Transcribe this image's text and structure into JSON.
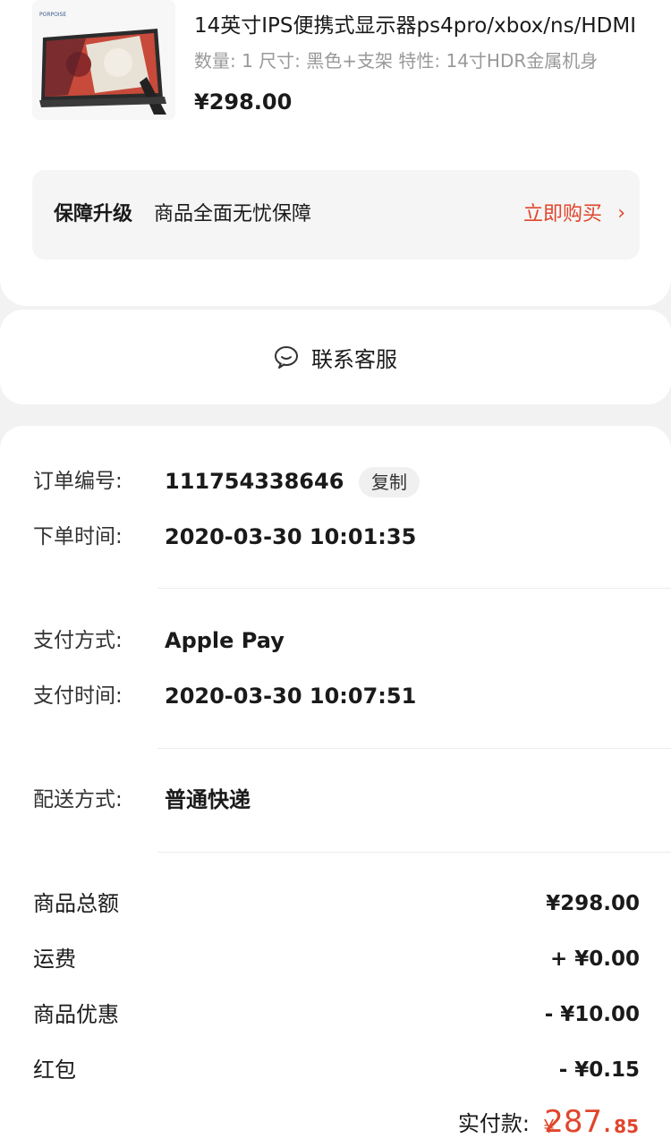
{
  "product": {
    "image_brand": "PORPOISE",
    "title": "14英寸IPS便携式显示器ps4pro/xbox/ns/HDMI",
    "spec": "数量: 1  尺寸: 黑色+支架  特性: 14寸HDR金属机身",
    "price": "¥298.00"
  },
  "guarantee": {
    "label": "保障升级",
    "description": "商品全面无忧保障",
    "action": "立即购买",
    "chevron": "›"
  },
  "service": {
    "icon": "chat-bubble-icon",
    "label": "联系客服"
  },
  "order": {
    "number_label": "订单编号:",
    "number": "111754338646",
    "copy_label": "复制",
    "created_label": "下单时间:",
    "created": "2020-03-30 10:01:35",
    "pay_method_label": "支付方式:",
    "pay_method": "Apple Pay",
    "pay_time_label": "支付时间:",
    "pay_time": "2020-03-30 10:07:51",
    "delivery_label": "配送方式:",
    "delivery": "普通快递"
  },
  "summary": {
    "items": [
      {
        "label": "商品总额",
        "value": "¥298.00"
      },
      {
        "label": "运费",
        "value": "+ ¥0.00"
      },
      {
        "label": "商品优惠",
        "value": "- ¥10.00"
      },
      {
        "label": "红包",
        "value": "- ¥0.15"
      }
    ],
    "paid_label": "实付款:",
    "paid_currency": "¥",
    "paid_integer": "287.",
    "paid_decimal": "85"
  },
  "colors": {
    "accent": "#e0452b",
    "background": "#f2f2f2",
    "card": "#ffffff"
  }
}
